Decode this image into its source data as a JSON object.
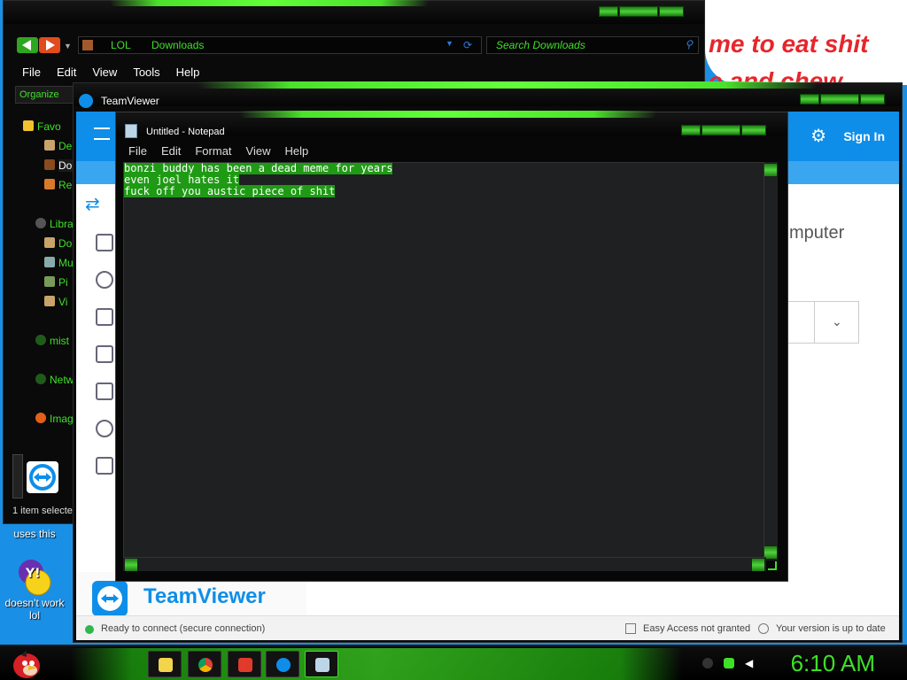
{
  "desktop": {
    "wallpaper_text": [
      "me to eat shit",
      "e and chew"
    ],
    "icons": [
      {
        "label": "uses this",
        "icon": "teamviewer-icon"
      },
      {
        "label": "doesn't work lol",
        "icon": "yahoo-messenger-icon"
      }
    ]
  },
  "explorer": {
    "breadcrumb": [
      "LOL",
      "Downloads"
    ],
    "search_placeholder": "Search Downloads",
    "menu": [
      "File",
      "Edit",
      "View",
      "Tools",
      "Help"
    ],
    "toolbar": {
      "organize": "Organize"
    },
    "sidebar": [
      {
        "label": "Favo",
        "icon": "star-icon"
      },
      {
        "label": "De",
        "icon": "desktop-icon"
      },
      {
        "label": "Do",
        "icon": "downloads-icon"
      },
      {
        "label": "Re",
        "icon": "recent-icon"
      },
      {
        "label": "Libra",
        "icon": "library-icon"
      },
      {
        "label": "Do",
        "icon": "documents-icon"
      },
      {
        "label": "Mu",
        "icon": "music-icon"
      },
      {
        "label": "Pi",
        "icon": "pictures-icon"
      },
      {
        "label": "Vi",
        "icon": "videos-icon"
      },
      {
        "label": "mist",
        "icon": "homegroup-icon"
      },
      {
        "label": "Netw",
        "icon": "network-icon"
      },
      {
        "label": "Imag",
        "icon": "image-icon"
      }
    ],
    "status": "1 item selecte"
  },
  "teamviewer": {
    "title": "TeamViewer",
    "sign_in": "Sign In",
    "heading_fragment": "mputer",
    "brand": "TeamViewer",
    "footer": {
      "connection": "Ready to connect (secure connection)",
      "easy_access": "Easy Access not granted",
      "version": "Your version is up to date"
    }
  },
  "notepad": {
    "title": "Untitled - Notepad",
    "menu": [
      "File",
      "Edit",
      "Format",
      "View",
      "Help"
    ],
    "lines": [
      "bonzi buddy has been a dead meme for years",
      "even joel hates it",
      "fuck off you austic piece of shit"
    ]
  },
  "taskbar": {
    "clock": "6:10 AM",
    "start_icon": "angry-bird-icon",
    "buttons": [
      "explorer-icon",
      "chrome-icon",
      "media-player-icon",
      "teamviewer-icon",
      "notepad-icon"
    ],
    "tray": [
      "network-icon",
      "battery-icon",
      "volume-icon"
    ]
  },
  "colors": {
    "accent_green": "#3ee028",
    "teamviewer_blue": "#0e8ee9",
    "window_black": "#0a0a0a",
    "desktop_blue": "#1a8fe6"
  }
}
